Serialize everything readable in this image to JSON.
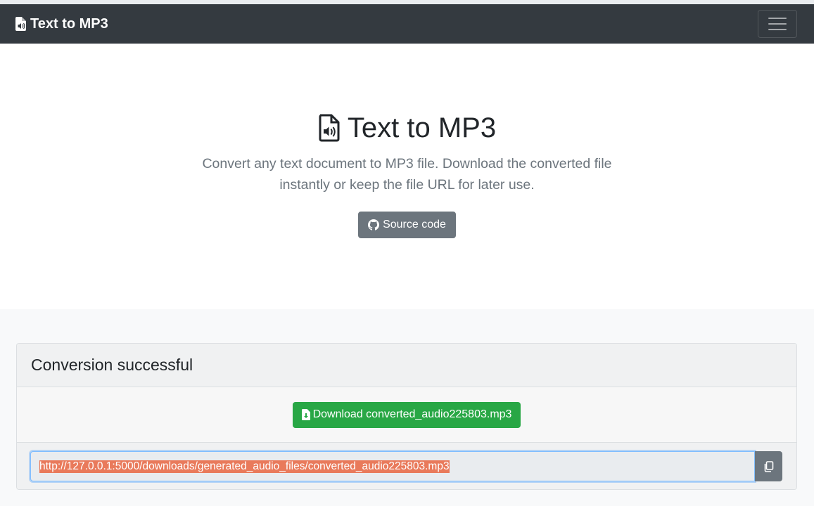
{
  "navbar": {
    "brand": "Text to MP3",
    "brand_icon": "file-audio-icon",
    "toggler_icon": "hamburger-icon"
  },
  "hero": {
    "title": "Text to MP3",
    "title_icon": "file-audio-icon",
    "lead": "Convert any text document to MP3 file. Download the converted file instantly or keep the file URL for later use.",
    "source_button": "Source code",
    "source_icon": "github-icon"
  },
  "result": {
    "header": "Conversion successful",
    "download_button": "Download converted_audio225803.mp3",
    "download_icon": "file-download-icon",
    "url": "http://127.0.0.1:5000/downloads/generated_audio_files/converted_audio225803.mp3",
    "copy_icon": "copy-icon"
  },
  "colors": {
    "navbar_bg": "#343a40",
    "secondary": "#6c757d",
    "success": "#28a745",
    "selection": "#e97a5b"
  }
}
